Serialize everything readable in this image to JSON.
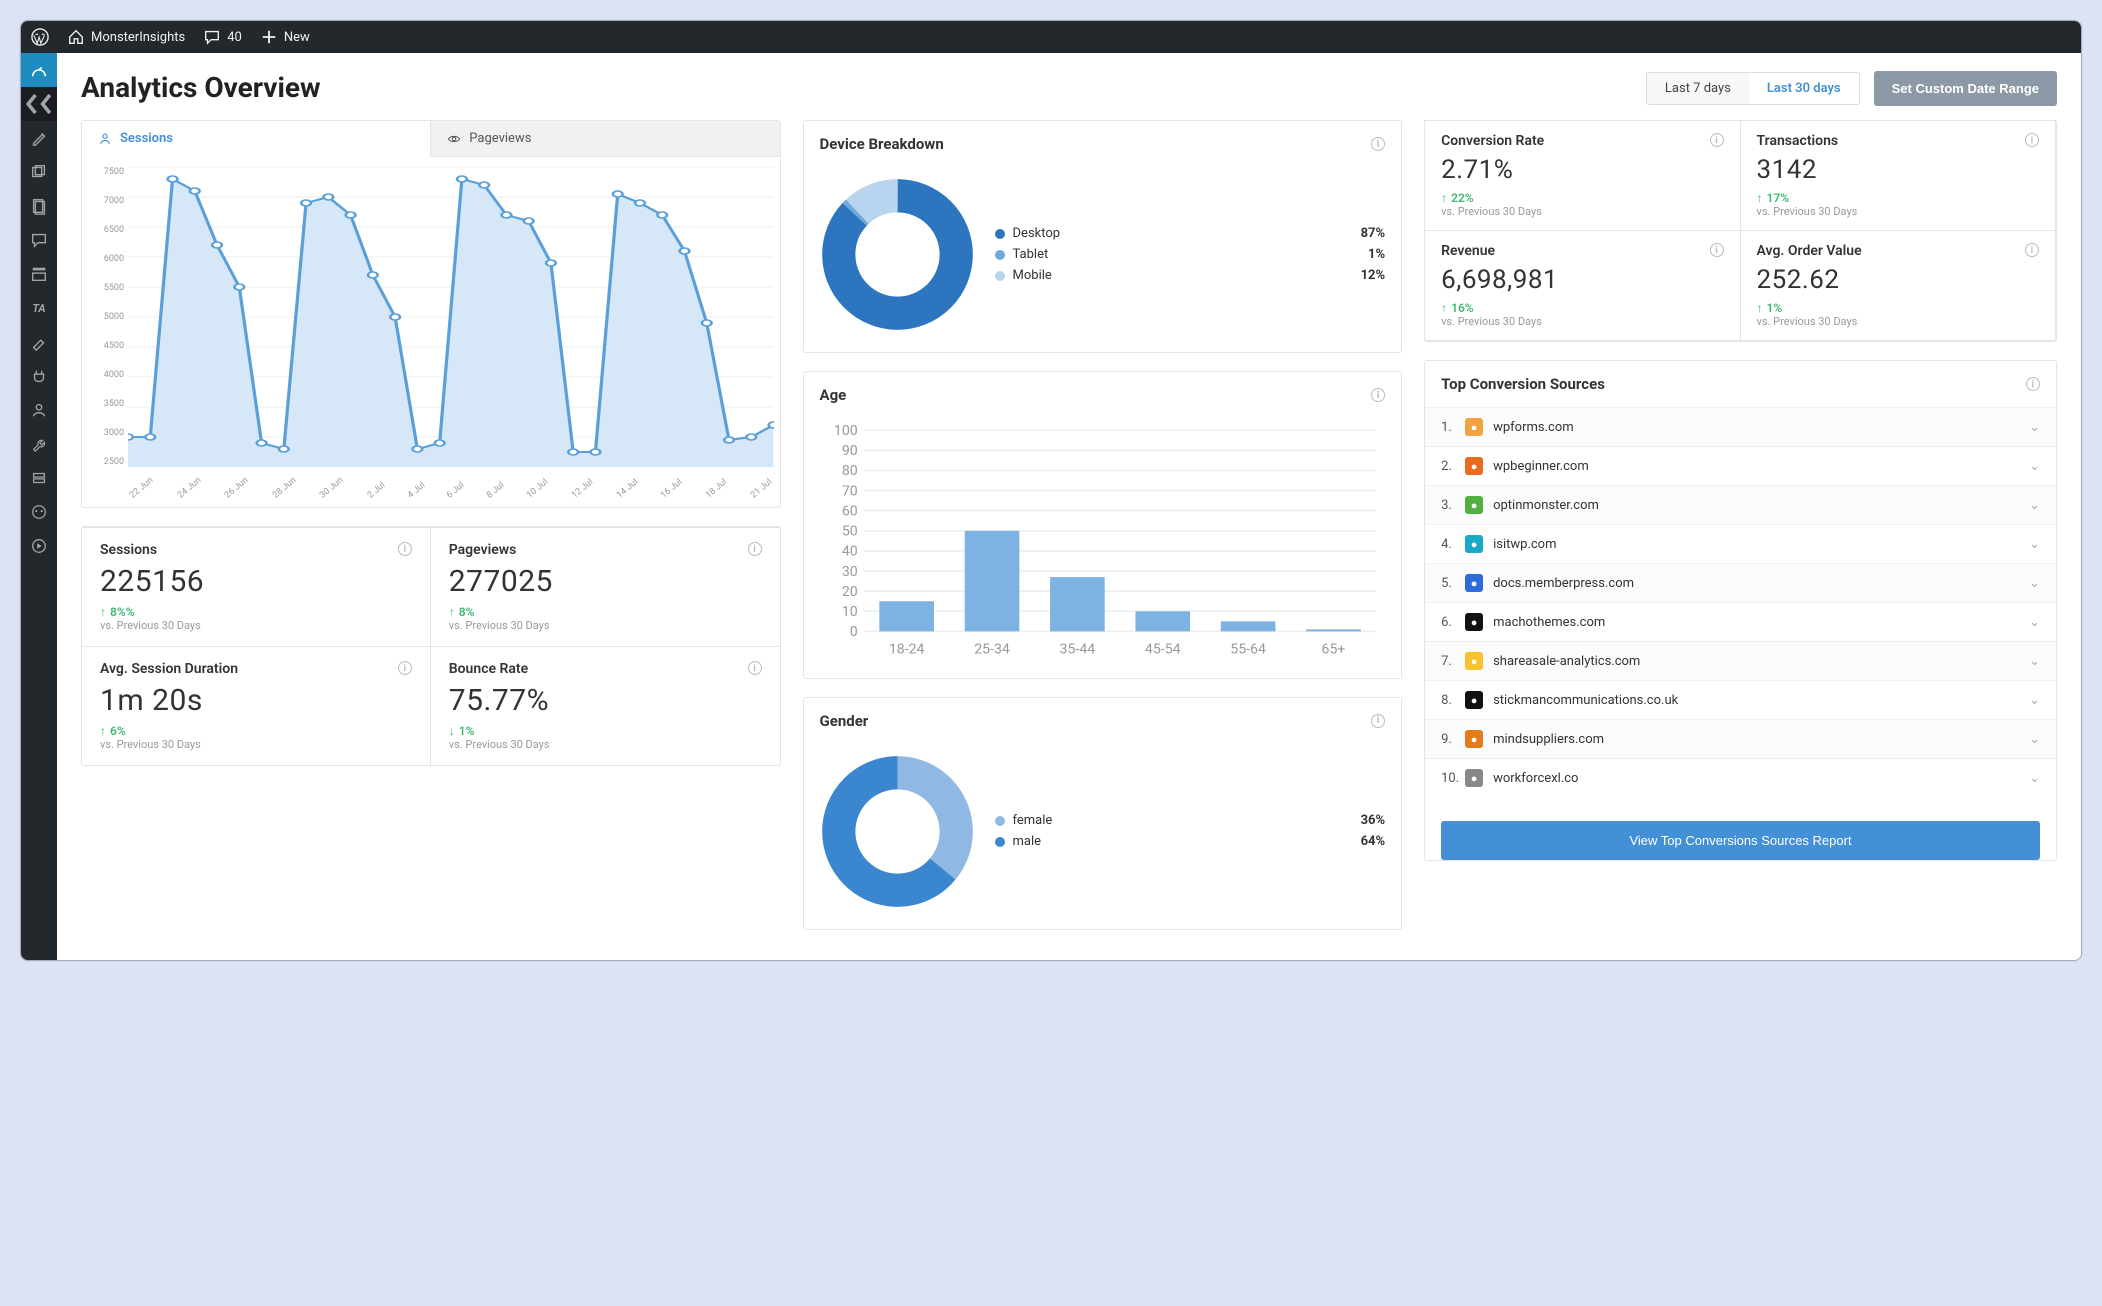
{
  "admin_bar": {
    "site_name": "MonsterInsights",
    "comments_count": "40",
    "new_label": "New"
  },
  "page_title": "Analytics Overview",
  "date_controls": {
    "last7": "Last 7 days",
    "last30": "Last 30 days",
    "custom": "Set Custom Date Range",
    "active": "last30"
  },
  "main_chart": {
    "tabs": {
      "sessions": "Sessions",
      "pageviews": "Pageviews"
    },
    "y_ticks": [
      "7500",
      "7000",
      "6500",
      "6000",
      "5500",
      "5000",
      "4500",
      "4000",
      "3500",
      "3000",
      "2500"
    ],
    "x_ticks": [
      "22 Jun",
      "24 Jun",
      "26 Jun",
      "28 Jun",
      "30 Jun",
      "2 Jul",
      "4 Jul",
      "6 Jul",
      "8 Jul",
      "10 Jul",
      "12 Jul",
      "14 Jul",
      "16 Jul",
      "18 Jul",
      "21 Jul"
    ]
  },
  "chart_data": [
    {
      "id": "sessions_line",
      "type": "line",
      "title": "Sessions",
      "xlabel": "",
      "ylabel": "",
      "ylim": [
        2500,
        7500
      ],
      "x": [
        "22 Jun",
        "23 Jun",
        "24 Jun",
        "25 Jun",
        "26 Jun",
        "27 Jun",
        "28 Jun",
        "29 Jun",
        "30 Jun",
        "1 Jul",
        "2 Jul",
        "3 Jul",
        "4 Jul",
        "5 Jul",
        "6 Jul",
        "7 Jul",
        "8 Jul",
        "9 Jul",
        "10 Jul",
        "11 Jul",
        "12 Jul",
        "13 Jul",
        "14 Jul",
        "15 Jul",
        "16 Jul",
        "17 Jul",
        "18 Jul",
        "19 Jul",
        "20 Jul",
        "21 Jul"
      ],
      "values": [
        3000,
        3000,
        7300,
        7100,
        6200,
        5500,
        2900,
        2800,
        6900,
        7000,
        6700,
        5700,
        5000,
        2800,
        2900,
        7300,
        7200,
        6700,
        6600,
        5900,
        2750,
        2750,
        7050,
        6900,
        6700,
        6100,
        4900,
        2950,
        3000,
        3200
      ]
    },
    {
      "id": "device_breakdown",
      "type": "pie",
      "title": "Device Breakdown",
      "categories": [
        "Desktop",
        "Tablet",
        "Mobile"
      ],
      "values": [
        87,
        1,
        12
      ],
      "colors": [
        "#2d76bf",
        "#6fa9dd",
        "#b9d4ee"
      ]
    },
    {
      "id": "age",
      "type": "bar",
      "title": "Age",
      "ylim": [
        0,
        100
      ],
      "y_ticks": [
        0,
        10,
        20,
        30,
        40,
        50,
        60,
        70,
        80,
        90,
        100
      ],
      "categories": [
        "18-24",
        "25-34",
        "35-44",
        "45-54",
        "55-64",
        "65+"
      ],
      "values": [
        15,
        50,
        27,
        10,
        5,
        1
      ]
    },
    {
      "id": "gender",
      "type": "pie",
      "title": "Gender",
      "categories": [
        "female",
        "male"
      ],
      "values": [
        36,
        64
      ],
      "colors": [
        "#8fb9e2",
        "#3b87cf"
      ]
    }
  ],
  "stats": {
    "sessions": {
      "label": "Sessions",
      "value": "225156",
      "delta": "8%%",
      "dir": "up",
      "note": "vs. Previous 30 Days"
    },
    "pageviews": {
      "label": "Pageviews",
      "value": "277025",
      "delta": "8%",
      "dir": "up",
      "note": "vs. Previous 30 Days"
    },
    "avg_dur": {
      "label": "Avg. Session Duration",
      "value": "1m 20s",
      "delta": "6%",
      "dir": "up",
      "note": "vs. Previous 30 Days"
    },
    "bounce": {
      "label": "Bounce Rate",
      "value": "75.77%",
      "delta": "1%",
      "dir": "down",
      "note": "vs. Previous 30 Days"
    }
  },
  "rstats": {
    "conversion": {
      "label": "Conversion Rate",
      "value": "2.71%",
      "delta": "22%",
      "dir": "up",
      "note": "vs. Previous 30 Days"
    },
    "transactions": {
      "label": "Transactions",
      "value": "3142",
      "delta": "17%",
      "dir": "up",
      "note": "vs. Previous 30 Days"
    },
    "revenue": {
      "label": "Revenue",
      "value": "6,698,981",
      "delta": "16%",
      "dir": "up",
      "note": "vs. Previous 30 Days"
    },
    "aov": {
      "label": "Avg. Order Value",
      "value": "252.62",
      "delta": "1%",
      "dir": "up",
      "note": "vs. Previous 30 Days"
    }
  },
  "device_card_title": "Device Breakdown",
  "age_card_title": "Age",
  "gender_card_title": "Gender",
  "sources": {
    "title": "Top Conversion Sources",
    "button": "View Top Conversions Sources Report",
    "items": [
      {
        "n": "1.",
        "name": "wpforms.com",
        "color": "#f0a33e"
      },
      {
        "n": "2.",
        "name": "wpbeginner.com",
        "color": "#e86b1f"
      },
      {
        "n": "3.",
        "name": "optinmonster.com",
        "color": "#52b043"
      },
      {
        "n": "4.",
        "name": "isitwp.com",
        "color": "#19a9c4"
      },
      {
        "n": "5.",
        "name": "docs.memberpress.com",
        "color": "#2e6bd6"
      },
      {
        "n": "6.",
        "name": "machothemes.com",
        "color": "#111"
      },
      {
        "n": "7.",
        "name": "shareasale-analytics.com",
        "color": "#f6c22e"
      },
      {
        "n": "8.",
        "name": "stickmancommunications.co.uk",
        "color": "#111"
      },
      {
        "n": "9.",
        "name": "mindsuppliers.com",
        "color": "#e37b19"
      },
      {
        "n": "10.",
        "name": "workforcexl.co",
        "color": "#888"
      }
    ]
  }
}
